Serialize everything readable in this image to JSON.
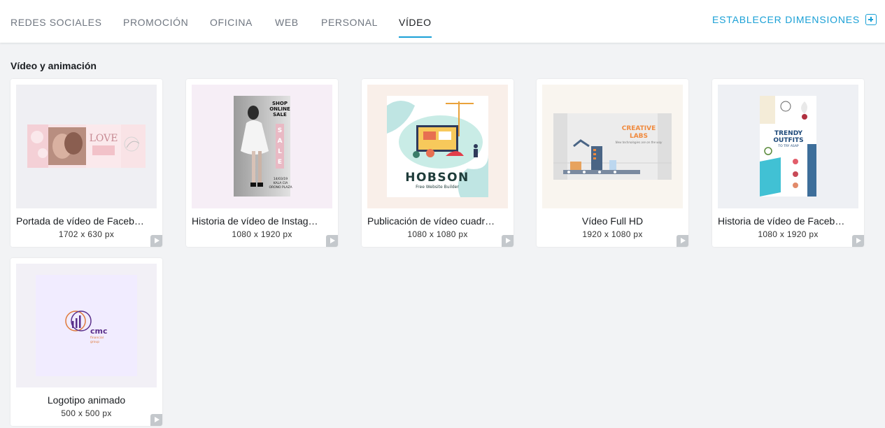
{
  "tabs": [
    {
      "label": "REDES  SOCIALES"
    },
    {
      "label": "PROMOCIÓN"
    },
    {
      "label": "OFICINA"
    },
    {
      "label": "WEB"
    },
    {
      "label": "PERSONAL"
    },
    {
      "label": "VÍDEO",
      "active": true
    }
  ],
  "set_dimensions_label": "ESTABLECER DIMENSIONES",
  "section_title": "Vídeo y animación",
  "colors": {
    "accent": "#1aa0d6",
    "page_bg": "#f2f3f5",
    "card_bg": "#ffffff"
  },
  "cards": [
    {
      "title": "Portada de vídeo de Faceb…",
      "size": "1702 x 630 px",
      "thumb_text": {
        "love1": "LOVE"
      }
    },
    {
      "title": "Historia de vídeo de Instag…",
      "size": "1080 x 1920 px",
      "thumb_text": {
        "shop": "SHOP ONLINE SALE",
        "sale": "SALE",
        "info": "14/03/19 KALA CIA ORONO PLAZA"
      }
    },
    {
      "title": "Publicación de vídeo cuadr…",
      "size": "1080 x 1080 px",
      "thumb_text": {
        "brand": "HOBSON",
        "tagline": "Free Website Builder"
      }
    },
    {
      "title": "Vídeo Full HD",
      "size": "1920 x 1080 px",
      "thumb_text": {
        "brand": "CREATIVE LABS",
        "tagline": "New technologies are on the way"
      }
    },
    {
      "title": "Historia de vídeo de Faceb…",
      "size": "1080 x 1920 px",
      "thumb_text": {
        "line1": "TRENDY",
        "line2": "OUTFITS",
        "line3": "TO TRY ASAP"
      }
    },
    {
      "title": "Logotipo animado",
      "size": "500 x 500 px",
      "thumb_text": {
        "brand": "cmc",
        "sub": "financial group"
      }
    }
  ]
}
